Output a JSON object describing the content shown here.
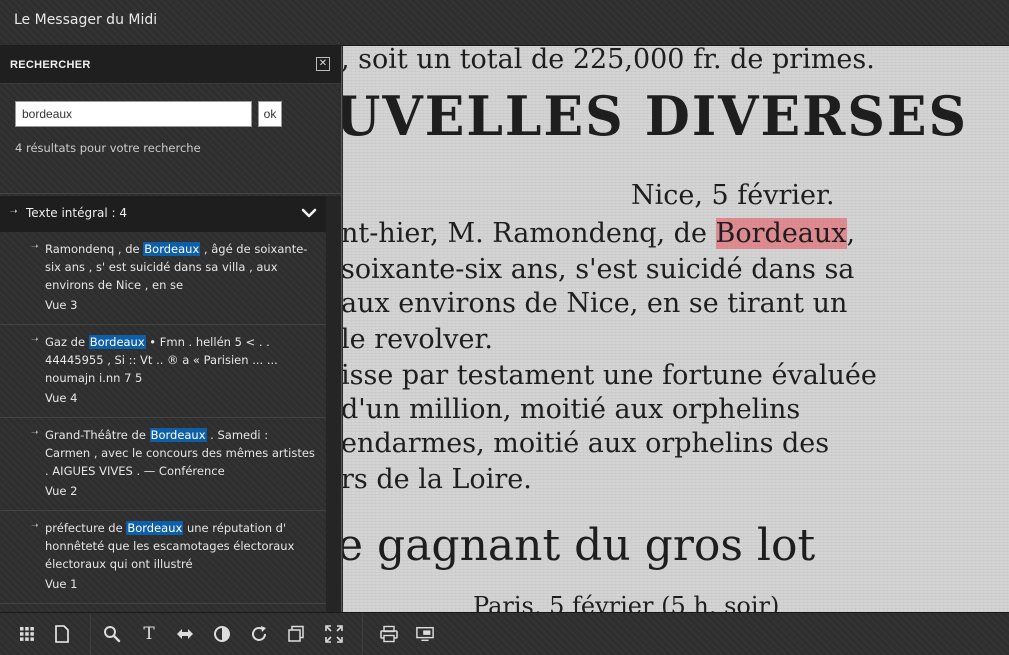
{
  "app": {
    "title": "Le Messager du Midi"
  },
  "search_panel": {
    "heading": "RECHERCHER",
    "close_label": "✕",
    "query": "bordeaux",
    "submit_label": "ok",
    "result_count": "4 résultats pour votre recherche",
    "section_label": "Texte intégral : 4",
    "results": [
      {
        "before": "Ramondenq , de ",
        "match": "Bordeaux",
        "after": " , âgé de soixante-six ans , s' est suicidé dans sa villa , aux environs de Nice , en se",
        "view": "Vue 3"
      },
      {
        "before": "Gaz de ",
        "match": "Bordeaux",
        "after": " • Fmn . hellén 5 < . . 44445955 , Si :: Vt .. ® a « Parisien ... ... noumajn i.nn 7 5",
        "view": "Vue 4"
      },
      {
        "before": "Grand-Théâtre de ",
        "match": "Bordeaux",
        "after": " . Samedi : Carmen , avec le concours des mêmes artistes . AIGUES VIVES . — Conférence",
        "view": "Vue 2"
      },
      {
        "before": "préfecture de ",
        "match": "Bordeaux",
        "after": " une réputation d' honnêteté que les escamotages électoraux électoraux qui ont illustré",
        "view": "Vue 1"
      }
    ]
  },
  "page_text": {
    "line1": ", soit un total de 225,000 fr. de primes.",
    "heading": "UVELLES  DIVERSES",
    "dateline": "Nice, 5 février.",
    "line3_before": "nt-hier, M. Ramondenq, de ",
    "line3_match": "Bordeaux",
    "line3_after": ",",
    "line4": " soixante-six ans, s'est  suicidé dans sa",
    "line5": "aux environs de Nice, en se tirant  un",
    "line6": "le revolver.",
    "line7": "isse par testament une fortune évaluée",
    "line8": "  d'un million,  moitié  aux orphelins",
    "line9": "endarmes, moitié aux  orphelins  des",
    "line10": "rs de la Loire.",
    "line11": "e gagnant du gros lot",
    "line12": "Paris, 5 février (5 h. soir)"
  },
  "toolbar": {
    "icons": [
      "grid-view-icon",
      "single-page-icon",
      "zoom-icon",
      "text-icon",
      "contrast-toggle-icon",
      "brightness-icon",
      "rotate-icon",
      "copy-icon",
      "fullscreen-icon",
      "print-icon",
      "screen-icon"
    ],
    "text_tool_label": "T"
  }
}
